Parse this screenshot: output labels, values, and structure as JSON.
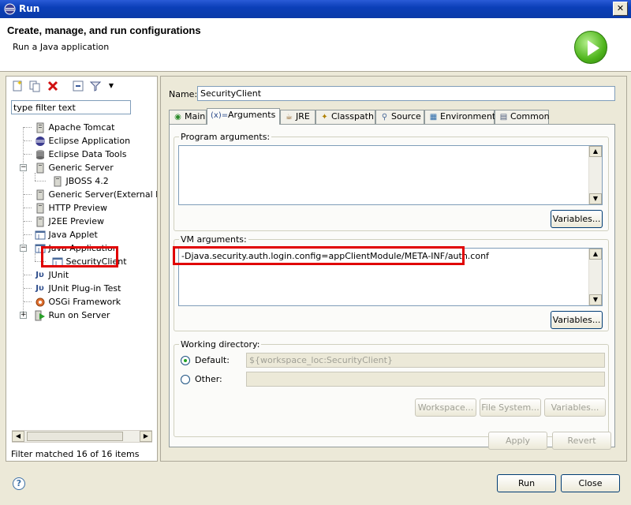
{
  "window": {
    "title": "Run",
    "close_glyph": "✕"
  },
  "header": {
    "title": "Create, manage, and run configurations",
    "subtitle": "Run a Java application",
    "badge_icon": "run-play-icon"
  },
  "left": {
    "filter_placeholder": "type filter text",
    "filter_value": "type filter text",
    "tree": [
      {
        "label": "Apache Tomcat",
        "icon": "server-icon"
      },
      {
        "label": "Eclipse Application",
        "icon": "eclipse-icon"
      },
      {
        "label": "Eclipse Data Tools",
        "icon": "database-icon"
      },
      {
        "label": "Generic Server",
        "icon": "server-icon"
      },
      {
        "label": "JBOSS 4.2",
        "icon": "server-icon"
      },
      {
        "label": "Generic Server(External Laun",
        "icon": "server-icon"
      },
      {
        "label": "HTTP Preview",
        "icon": "server-icon"
      },
      {
        "label": "J2EE Preview",
        "icon": "server-icon"
      },
      {
        "label": "Java Applet",
        "icon": "applet-icon"
      },
      {
        "label": "Java Application",
        "icon": "java-app-icon"
      },
      {
        "label": "SecurityClient",
        "icon": "java-app-icon"
      },
      {
        "label": "JUnit",
        "icon": "junit-icon"
      },
      {
        "label": "JUnit Plug-in Test",
        "icon": "junit-icon"
      },
      {
        "label": "OSGi Framework",
        "icon": "osgi-icon"
      },
      {
        "label": "Run on Server",
        "icon": "run-server-icon"
      }
    ],
    "status": "Filter matched 16 of 16 items"
  },
  "right": {
    "name_label": "Name:",
    "name_value": "SecurityClient",
    "tabs": [
      {
        "label": "Main",
        "icon": "main-tab-icon",
        "glyph": "◉"
      },
      {
        "label": "Arguments",
        "icon": "arguments-tab-icon",
        "glyph": "(x)="
      },
      {
        "label": "JRE",
        "icon": "jre-tab-icon",
        "glyph": "☕"
      },
      {
        "label": "Classpath",
        "icon": "classpath-tab-icon",
        "glyph": "✦"
      },
      {
        "label": "Source",
        "icon": "source-tab-icon",
        "glyph": "⚲"
      },
      {
        "label": "Environment",
        "icon": "environment-tab-icon",
        "glyph": "▦"
      },
      {
        "label": "Common",
        "icon": "common-tab-icon",
        "glyph": "▤"
      }
    ],
    "program_args": {
      "title": "Program arguments:",
      "value": "",
      "variables_label": "Variables..."
    },
    "vm_args": {
      "title": "VM arguments:",
      "value": "-Djava.security.auth.login.config=appClientModule/META-INF/auth.conf",
      "variables_label": "Variables..."
    },
    "working_dir": {
      "title": "Working directory:",
      "default_label": "Default:",
      "default_value": "${workspace_loc:SecurityClient}",
      "other_label": "Other:",
      "other_value": "",
      "workspace_label": "Workspace...",
      "filesystem_label": "File System...",
      "variables_label": "Variables..."
    },
    "apply_label": "Apply",
    "revert_label": "Revert"
  },
  "footer": {
    "run_label": "Run",
    "close_label": "Close",
    "help_glyph": "?"
  },
  "colors": {
    "highlight": "#e00000",
    "title_bar": "#0b3fb8"
  }
}
